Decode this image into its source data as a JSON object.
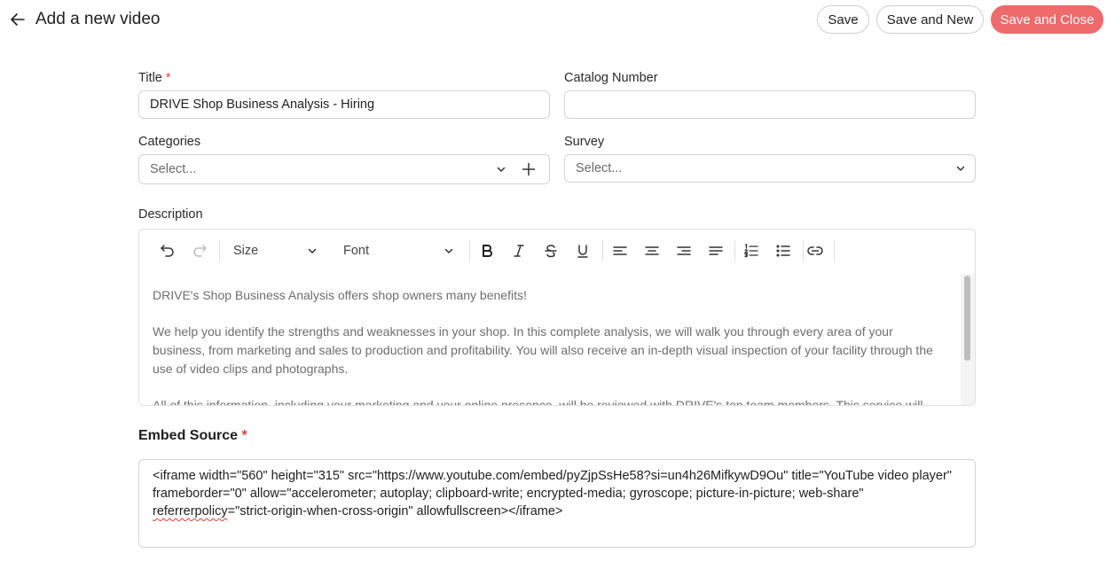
{
  "header": {
    "title": "Add a new video",
    "save_label": "Save",
    "save_new_label": "Save and New",
    "save_close_label": "Save and Close"
  },
  "form": {
    "title": {
      "label": "Title",
      "required_mark": "*",
      "value": "DRIVE Shop Business Analysis - Hiring"
    },
    "catalog_number": {
      "label": "Catalog Number",
      "value": ""
    },
    "categories": {
      "label": "Categories",
      "placeholder": "Select..."
    },
    "survey": {
      "label": "Survey",
      "placeholder": "Select..."
    },
    "description": {
      "label": "Description",
      "toolbar": {
        "size_label": "Size",
        "font_label": "Font"
      },
      "paragraphs": [
        "DRIVE's Shop Business Analysis offers shop owners many benefits!",
        "We help you identify the strengths and weaknesses in your shop. In this complete analysis, we will walk you through every area of your business, from marketing and sales to production and profitability. You will also receive an in-depth visual inspection of your facility through the use of video clips and photographs.",
        "All of this information, including your marketing and your online presence, will be reviewed with DRIVE's top team members. This service will"
      ]
    },
    "embed_source": {
      "label": "Embed Source",
      "required_mark": "*",
      "value_part1": "<iframe width=\"560\" height=\"315\" src=\"https://www.youtube.com/embed/pyZjpSsHe58?si=un4h26MifkywD9Ou\" title=\"YouTube video player\" frameborder=\"0\" allow=\"accelerometer; autoplay; clipboard-write; encrypted-media; gyroscope; picture-in-picture; web-share\" ",
      "value_misspelled": "referrerpolicy",
      "value_part2": "=\"strict-origin-when-cross-origin\" allowfullscreen></iframe>"
    }
  },
  "colors": {
    "primary": "#ef6a6a",
    "required": "#e0403c",
    "border": "#d4d4d8"
  },
  "icons": {
    "back": "arrow-left-icon",
    "chevron": "chevron-down-icon",
    "add": "plus-icon",
    "undo": "undo-icon",
    "redo": "redo-icon",
    "bold": "bold-icon",
    "italic": "italic-icon",
    "strike": "strikethrough-icon",
    "underline": "underline-icon",
    "align_left": "align-left-icon",
    "align_center": "align-center-icon",
    "align_right": "align-right-icon",
    "align_justify": "align-justify-icon",
    "ordered_list": "ordered-list-icon",
    "bullet_list": "bullet-list-icon",
    "link": "link-icon"
  }
}
